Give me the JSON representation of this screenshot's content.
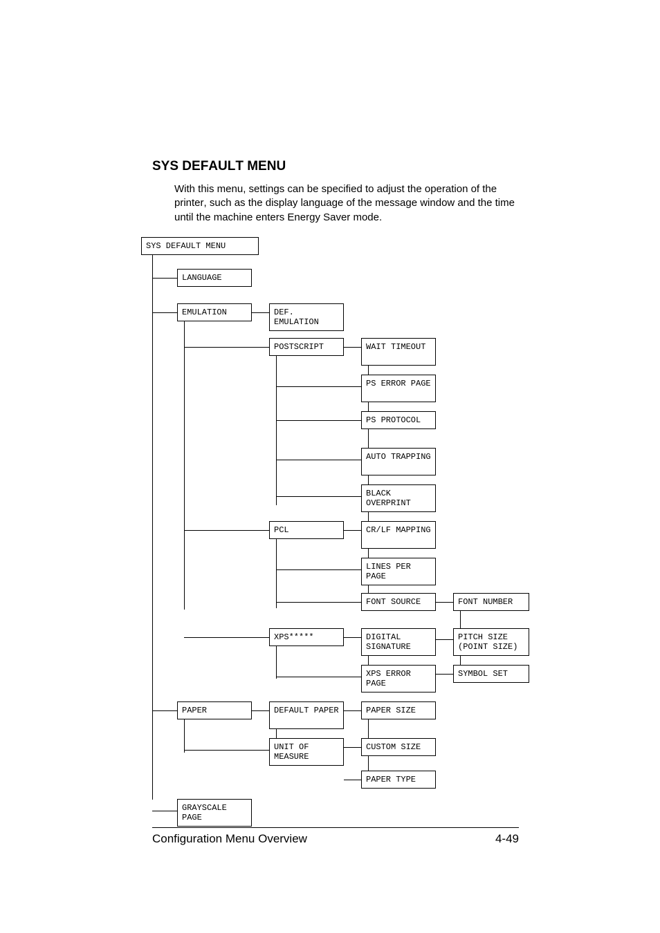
{
  "heading": "SYS DEFAULT MENU",
  "intro": "With this menu, settings can be specified to adjust the operation of the printer, such as the display language of the message window and the time until the machine enters Energy Saver mode.",
  "footer": {
    "left": "Configuration Menu Overview",
    "right": "4-49"
  },
  "nodes": {
    "root": "SYS DEFAULT MENU",
    "language": "LANGUAGE",
    "emulation": "EMULATION",
    "def_emulation": "DEF.\nEMULATION",
    "postscript": "POSTSCRIPT",
    "wait_timeout": "WAIT\nTIMEOUT",
    "ps_error_page": "PS ERROR\nPAGE",
    "ps_protocol": "PS PROTOCOL",
    "auto_trapping": "AUTO\nTRAPPING",
    "black_overprint": "BLACK\nOVERPRINT",
    "pcl": "PCL",
    "crlf_mapping": "CR/LF\nMAPPING",
    "lines_per_page": "LINES PER\nPAGE",
    "font_source": "FONT SOURCE",
    "xps": "XPS*****",
    "digital_sig": "DIGITAL\nSIGNATURE",
    "xps_error_page": "XPS ERROR\nPAGE",
    "font_number": "FONT NUMBER",
    "pitch_size": "PITCH SIZE\n(POINT SIZE)",
    "symbol_set": "SYMBOL SET",
    "paper": "PAPER",
    "default_paper": "DEFAULT\nPAPER",
    "unit_of_measure": "UNIT OF\nMEASURE",
    "paper_size": "PAPER SIZE",
    "custom_size": "CUSTOM SIZE",
    "paper_type": "PAPER TYPE",
    "grayscale_page": "GRAYSCALE\nPAGE"
  }
}
